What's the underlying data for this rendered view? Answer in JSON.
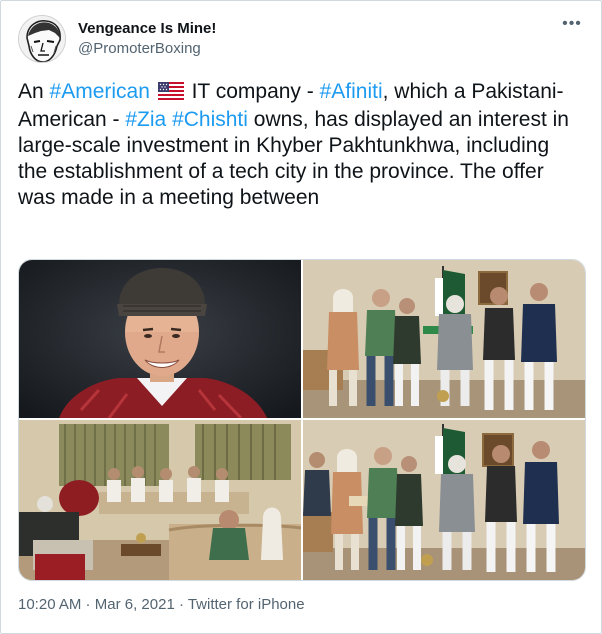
{
  "author": {
    "display_name": "Vengeance Is Mine!",
    "handle": "@PromoterBoxing",
    "avatar_icon": "sketch-portrait-avatar"
  },
  "more_icon": "more-horizontal-icon",
  "tweet": {
    "seg1": "An ",
    "tag_american": "#American",
    "flag_icon": "us-flag-emoji",
    "seg2": " IT company - ",
    "tag_afiniti": "#Afiniti",
    "seg3": ", which a Pakistani-American - ",
    "tag_zia": "#Zia",
    "seg4": " ",
    "tag_chishti": "#Chishti",
    "seg5": " owns, has displayed an interest in large-scale investment in Khyber Pakhtunkhwa, including the establishment of a tech city in the province. The offer was made in a meeting between"
  },
  "colors": {
    "link": "#1d9bf0",
    "text": "#0f1419",
    "secondary": "#536471",
    "border": "#cfd9de"
  },
  "meta": {
    "time": "10:20 AM",
    "separator": " · ",
    "date": "Mar 6, 2021",
    "source": "Twitter for iPhone"
  }
}
